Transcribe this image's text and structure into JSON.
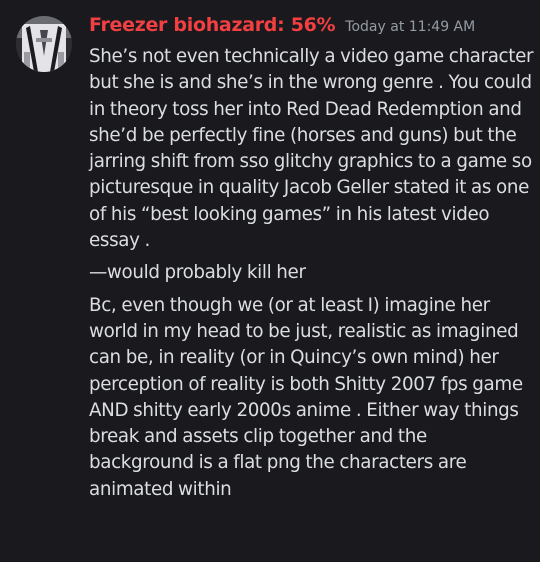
{
  "message": {
    "author": {
      "name": "Freezer biohazard: 56%",
      "name_color": "#f23f42",
      "avatar": "profile-avatar"
    },
    "timestamp": "Today at 11:49 AM",
    "paragraphs": [
      "She’s not even technically a video game character but she is and she’s in the wrong genre . You could in theory toss her into Red Dead Redemption and she’d be perfectly fine (horses and guns) but the jarring shift from sso glitchy graphics to a game so picturesque in quality Jacob Geller stated it as one of his “best looking games” in his latest video essay .",
      "—would probably kill her",
      "Bc, even though we (or at least I) imagine her world in my head to be just, realistic as imagined can be, in reality (or in Quincy’s own mind) her perception of reality is both Shitty 2007 fps game AND shitty early 2000s anime . Either way things break and assets clip together and the background is a flat png the characters are animated within"
    ]
  },
  "colors": {
    "background": "#1a1a1e",
    "text": "#dbdee1",
    "muted": "#949ba4"
  }
}
